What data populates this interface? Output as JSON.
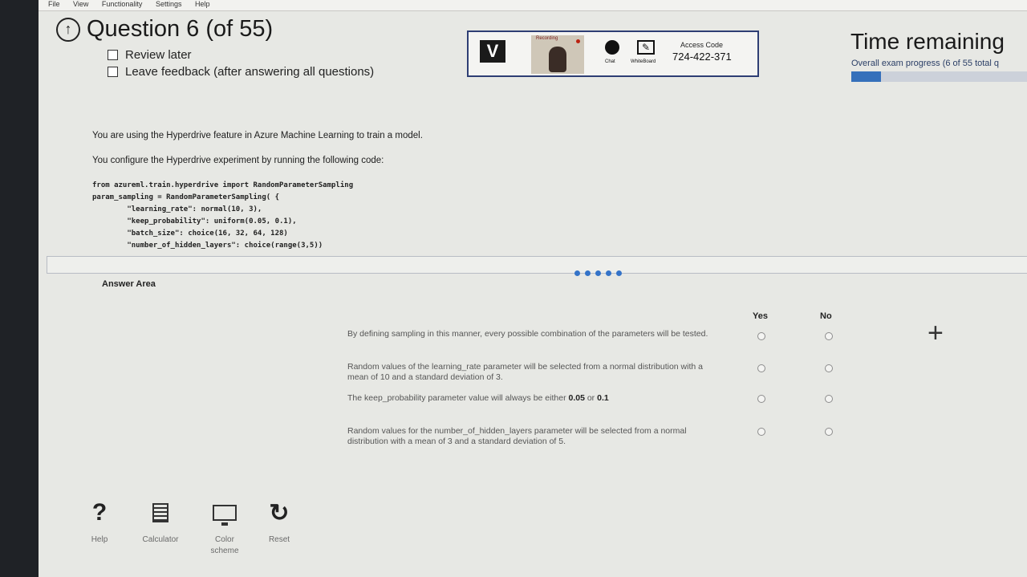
{
  "menubar": [
    "File",
    "View",
    "Functionality",
    "Settings",
    "Help"
  ],
  "header": {
    "title": "Question 6 (of 55)",
    "review_later": "Review later",
    "leave_feedback": "Leave feedback (after answering all questions)",
    "time_remaining": "Time remaining",
    "progress_label": "Overall exam progress (6 of 55 total q",
    "progress_fraction": 0.17
  },
  "proctor": {
    "logo": "V",
    "recording": "Recording",
    "chat_label": "Chat",
    "whiteboard_label": "WhiteBoard",
    "access_code_label": "Access Code",
    "access_code": "724-422-371"
  },
  "question": {
    "p1": "You are using the Hyperdrive feature in Azure Machine Learning to train a model.",
    "p2": "You configure the Hyperdrive experiment by running the following code:",
    "code": "from azureml.train.hyperdrive import RandomParameterSampling\nparam_sampling = RandomParameterSampling( {\n        \"learning_rate\": normal(10, 3),\n        \"keep_probability\": uniform(0.05, 0.1),\n        \"batch_size\": choice(16, 32, 64, 128)\n        \"number_of_hidden_layers\": choice(range(3,5))"
  },
  "answer_area": {
    "title": "Answer Area",
    "yes": "Yes",
    "no": "No",
    "statements": [
      "By defining sampling in this manner, every possible combination of the parameters will be tested.",
      "Random values of the learning_rate parameter will be selected from a normal distribution with a mean of 10 and a standard deviation of 3.",
      "The keep_probability parameter value will always be either",
      "Random values for the number_of_hidden_layers parameter will be selected from a normal distribution with a mean of 3 and a standard deviation of 5."
    ],
    "stmt3_val1": "0.05",
    "stmt3_or": "or",
    "stmt3_val2": "0.1"
  },
  "toolbar": {
    "help": "Help",
    "calculator": "Calculator",
    "color_scheme_1": "Color",
    "color_scheme_2": "scheme",
    "reset": "Reset"
  }
}
